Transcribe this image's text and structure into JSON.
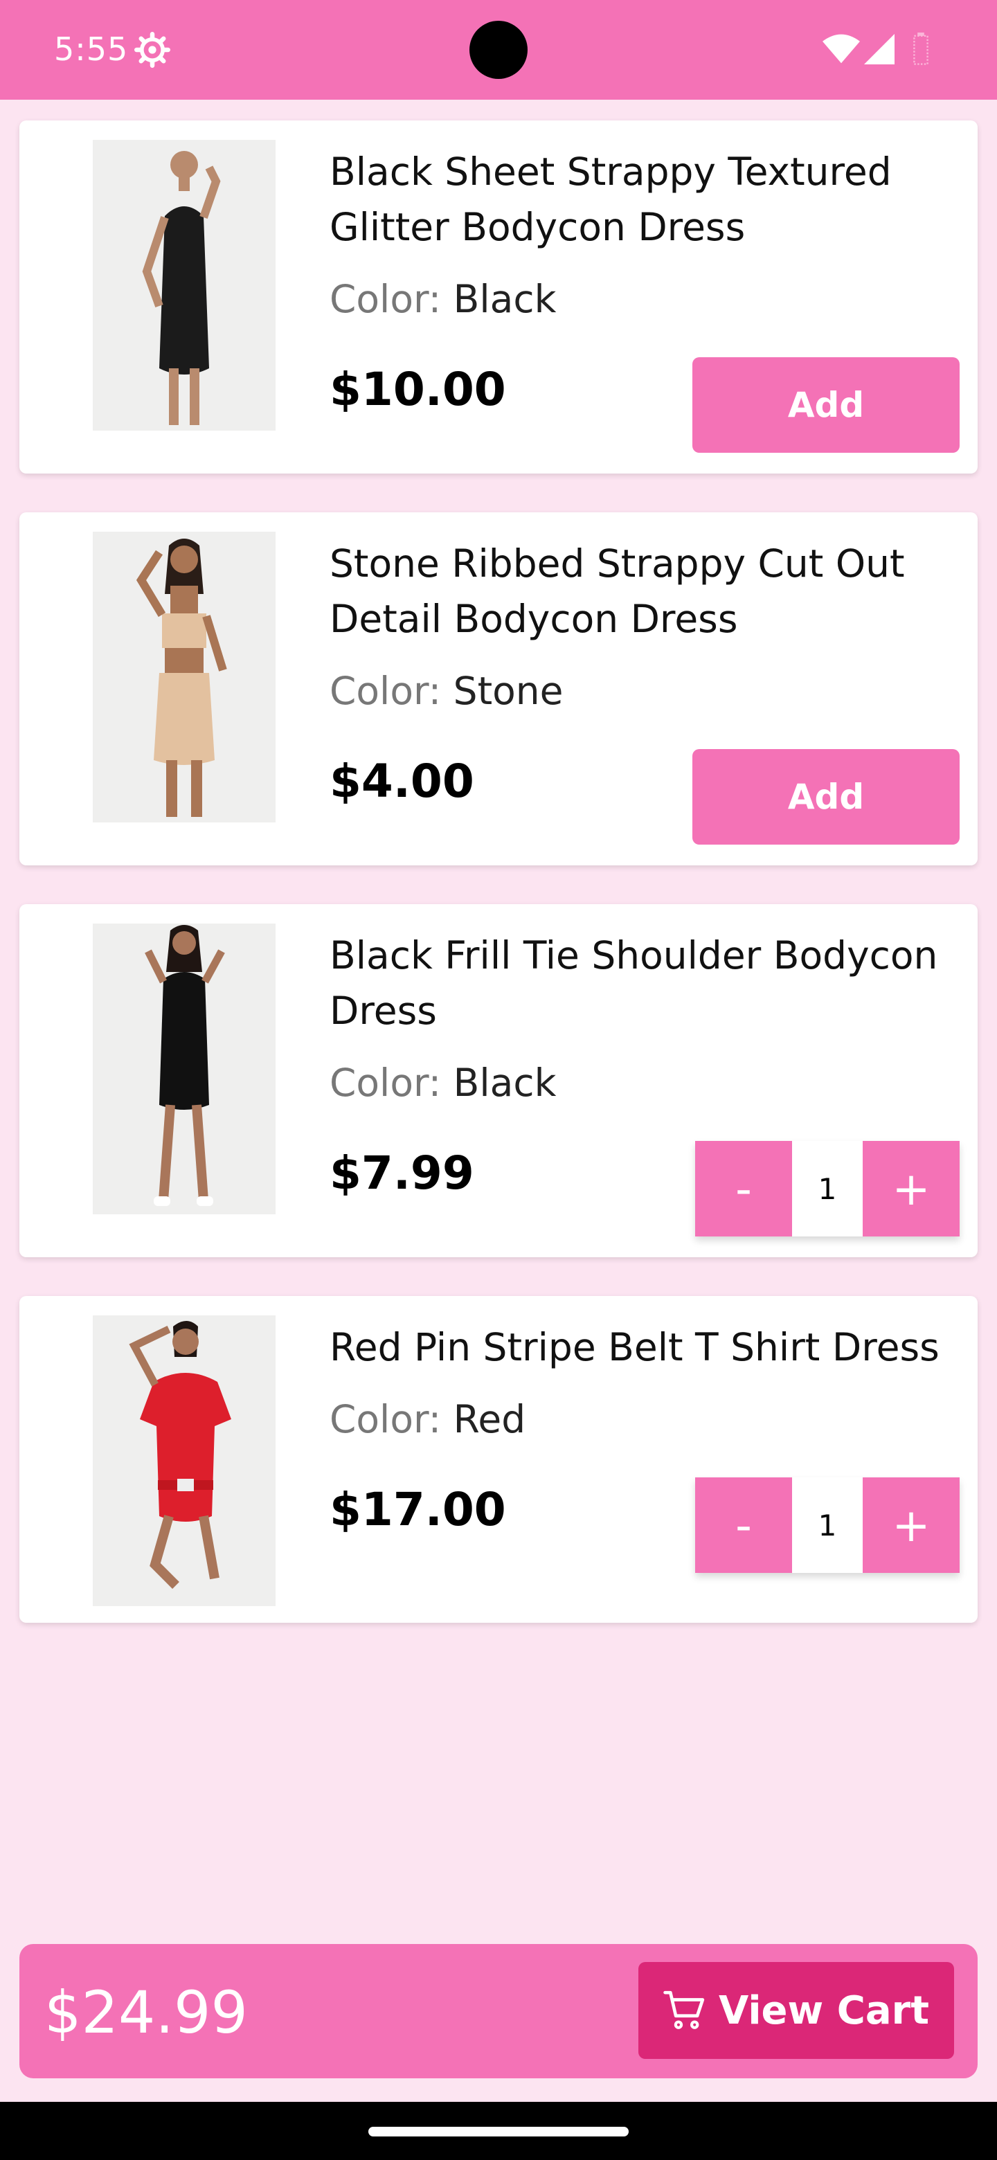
{
  "status_bar": {
    "time": "5:55",
    "icons": [
      "gear-icon",
      "wifi-icon",
      "signal-icon",
      "battery-icon"
    ]
  },
  "products": [
    {
      "name": "Black Sheet Strappy Textured Glitter Bodycon Dress",
      "color_label": "Color:",
      "color_value": "Black",
      "price": "$10.00",
      "action": "Add"
    },
    {
      "name": "Stone Ribbed Strappy Cut Out Detail Bodycon Dress",
      "color_label": "Color:",
      "color_value": "Stone",
      "price": "$4.00",
      "action": "Add"
    },
    {
      "name": "Black Frill Tie Shoulder Bodycon Dress",
      "color_label": "Color:",
      "color_value": "Black",
      "price": "$7.99",
      "stepper": {
        "minus": "-",
        "qty": "1",
        "plus": "+"
      }
    },
    {
      "name": "Red Pin Stripe Belt T Shirt Dress",
      "color_label": "Color:",
      "color_value": "Red",
      "price": "$17.00",
      "stepper": {
        "minus": "-",
        "qty": "1",
        "plus": "+"
      }
    }
  ],
  "cart": {
    "total": "$24.99",
    "button_label": "View Cart"
  },
  "colors": {
    "accent": "#f472b6",
    "accent_dark": "#db2777",
    "background": "#fce4f1"
  }
}
